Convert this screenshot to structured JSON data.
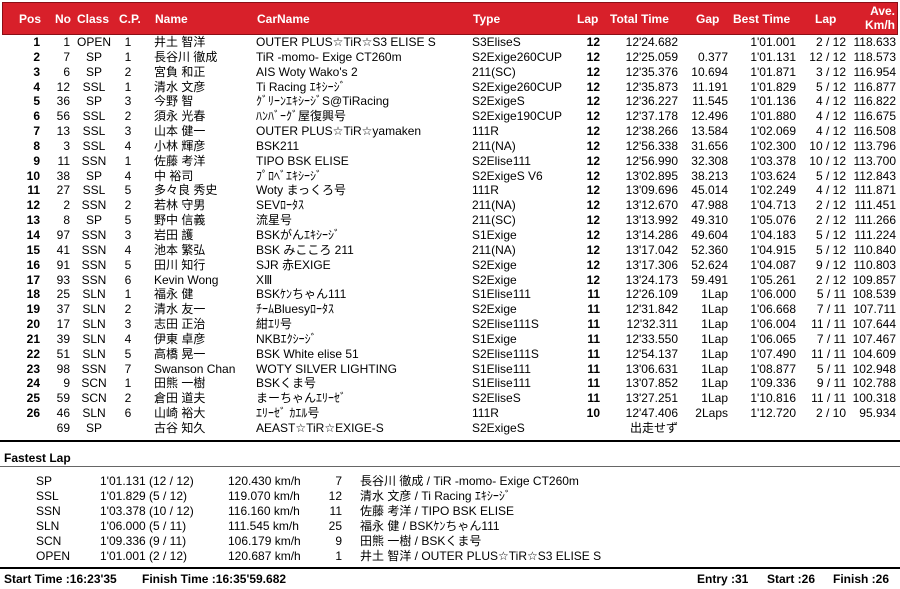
{
  "headers": {
    "pos": "Pos",
    "no": "No",
    "class": "Class",
    "cp": "C.P.",
    "name": "Name",
    "carname": "CarName",
    "type": "Type",
    "lap": "Lap",
    "total_time": "Total Time",
    "gap": "Gap",
    "best_time": "Best Time",
    "best_lap": "Lap",
    "ave_line1": "Ave.",
    "ave_line2": "Km/h"
  },
  "rows": [
    {
      "pos": "1",
      "no": "1",
      "class": "OPEN",
      "cp": "1",
      "name": "井土 智洋",
      "car": "OUTER PLUS☆TiR☆S3 ELISE S",
      "type": "S3EliseS",
      "lap": "12",
      "total": "12'24.682",
      "gap": "",
      "best": "1'01.001",
      "blap": "2 / 12",
      "ave": "118.633"
    },
    {
      "pos": "2",
      "no": "7",
      "class": "SP",
      "cp": "1",
      "name": "長谷川 徹成",
      "car": "TiR -momo- Exige CT260m",
      "type": "S2Exige260CUP",
      "lap": "12",
      "total": "12'25.059",
      "gap": "0.377",
      "best": "1'01.131",
      "blap": "12 / 12",
      "ave": "118.573"
    },
    {
      "pos": "3",
      "no": "6",
      "class": "SP",
      "cp": "2",
      "name": "宮負 和正",
      "car": "AIS Woty Wako's 2",
      "type": "211(SC)",
      "lap": "12",
      "total": "12'35.376",
      "gap": "10.694",
      "best": "1'01.871",
      "blap": "3 / 12",
      "ave": "116.954"
    },
    {
      "pos": "4",
      "no": "12",
      "class": "SSL",
      "cp": "1",
      "name": "清水 文彦",
      "car": "Ti Racing ｴｷｼｰｼﾞ",
      "type": "S2Exige260CUP",
      "lap": "12",
      "total": "12'35.873",
      "gap": "11.191",
      "best": "1'01.829",
      "blap": "5 / 12",
      "ave": "116.877"
    },
    {
      "pos": "5",
      "no": "36",
      "class": "SP",
      "cp": "3",
      "name": "今野 智",
      "car": "ｸﾞﾘｰﾝｴｷｼｰｼﾞS@TiRacing",
      "type": "S2ExigeS",
      "lap": "12",
      "total": "12'36.227",
      "gap": "11.545",
      "best": "1'01.136",
      "blap": "4 / 12",
      "ave": "116.822"
    },
    {
      "pos": "6",
      "no": "56",
      "class": "SSL",
      "cp": "2",
      "name": "須永 光春",
      "car": "ﾊﾝﾊﾞｰｸﾞ屋復興号",
      "type": "S2Exige190CUP",
      "lap": "12",
      "total": "12'37.178",
      "gap": "12.496",
      "best": "1'01.880",
      "blap": "4 / 12",
      "ave": "116.675"
    },
    {
      "pos": "7",
      "no": "13",
      "class": "SSL",
      "cp": "3",
      "name": "山本 健一",
      "car": "OUTER PLUS☆TiR☆yamaken",
      "type": "111R",
      "lap": "12",
      "total": "12'38.266",
      "gap": "13.584",
      "best": "1'02.069",
      "blap": "4 / 12",
      "ave": "116.508"
    },
    {
      "pos": "8",
      "no": "3",
      "class": "SSL",
      "cp": "4",
      "name": "小林 輝彦",
      "car": "BSK211",
      "type": "211(NA)",
      "lap": "12",
      "total": "12'56.338",
      "gap": "31.656",
      "best": "1'02.300",
      "blap": "10 / 12",
      "ave": "113.796"
    },
    {
      "pos": "9",
      "no": "11",
      "class": "SSN",
      "cp": "1",
      "name": "佐藤 考洋",
      "car": "TIPO BSK ELISE",
      "type": "S2Elise111",
      "lap": "12",
      "total": "12'56.990",
      "gap": "32.308",
      "best": "1'03.378",
      "blap": "10 / 12",
      "ave": "113.700"
    },
    {
      "pos": "10",
      "no": "38",
      "class": "SP",
      "cp": "4",
      "name": "中 裕司",
      "car": "ﾌﾟﾛﾍﾞｴｷｼｰｼﾞ",
      "type": "S2ExigeS V6",
      "lap": "12",
      "total": "13'02.895",
      "gap": "38.213",
      "best": "1'03.624",
      "blap": "5 / 12",
      "ave": "112.843"
    },
    {
      "pos": "11",
      "no": "27",
      "class": "SSL",
      "cp": "5",
      "name": "多々良 秀史",
      "car": "Woty まっくろ号",
      "type": "111R",
      "lap": "12",
      "total": "13'09.696",
      "gap": "45.014",
      "best": "1'02.249",
      "blap": "4 / 12",
      "ave": "111.871"
    },
    {
      "pos": "12",
      "no": "2",
      "class": "SSN",
      "cp": "2",
      "name": "若林 守男",
      "car": "SEVﾛｰﾀｽ",
      "type": "211(NA)",
      "lap": "12",
      "total": "13'12.670",
      "gap": "47.988",
      "best": "1'04.713",
      "blap": "2 / 12",
      "ave": "111.451"
    },
    {
      "pos": "13",
      "no": "8",
      "class": "SP",
      "cp": "5",
      "name": "野中 信義",
      "car": "流星号",
      "type": "211(SC)",
      "lap": "12",
      "total": "13'13.992",
      "gap": "49.310",
      "best": "1'05.076",
      "blap": "2 / 12",
      "ave": "111.266"
    },
    {
      "pos": "14",
      "no": "97",
      "class": "SSN",
      "cp": "3",
      "name": "岩田 護",
      "car": "BSKがんｴｷｼｰｼﾞ",
      "type": "S1Exige",
      "lap": "12",
      "total": "13'14.286",
      "gap": "49.604",
      "best": "1'04.183",
      "blap": "5 / 12",
      "ave": "111.224"
    },
    {
      "pos": "15",
      "no": "41",
      "class": "SSN",
      "cp": "4",
      "name": "池本 繁弘",
      "car": "BSK みこころ 211",
      "type": "211(NA)",
      "lap": "12",
      "total": "13'17.042",
      "gap": "52.360",
      "best": "1'04.915",
      "blap": "5 / 12",
      "ave": "110.840"
    },
    {
      "pos": "16",
      "no": "91",
      "class": "SSN",
      "cp": "5",
      "name": "田川 知行",
      "car": "SJR 赤EXIGE",
      "type": "S2Exige",
      "lap": "12",
      "total": "13'17.306",
      "gap": "52.624",
      "best": "1'04.087",
      "blap": "9 / 12",
      "ave": "110.803"
    },
    {
      "pos": "17",
      "no": "93",
      "class": "SSN",
      "cp": "6",
      "name": "Kevin Wong",
      "car": "XⅢ",
      "type": "S2Exige",
      "lap": "12",
      "total": "13'24.173",
      "gap": "59.491",
      "best": "1'05.261",
      "blap": "2 / 12",
      "ave": "109.857"
    },
    {
      "pos": "18",
      "no": "25",
      "class": "SLN",
      "cp": "1",
      "name": "福永 健",
      "car": "BSKｹﾝちゃん111",
      "type": "S1Elise111",
      "lap": "11",
      "total": "12'26.109",
      "gap": "1Lap",
      "best": "1'06.000",
      "blap": "5 / 11",
      "ave": "108.539"
    },
    {
      "pos": "19",
      "no": "37",
      "class": "SLN",
      "cp": "2",
      "name": "清水 友一",
      "car": "ﾁｰﾑBluesyﾛｰﾀｽ",
      "type": "S2Exige",
      "lap": "11",
      "total": "12'31.842",
      "gap": "1Lap",
      "best": "1'06.668",
      "blap": "7 / 11",
      "ave": "107.711"
    },
    {
      "pos": "20",
      "no": "17",
      "class": "SLN",
      "cp": "3",
      "name": "志田 正治",
      "car": "紺ｴﾘ号",
      "type": "S2Elise111S",
      "lap": "11",
      "total": "12'32.311",
      "gap": "1Lap",
      "best": "1'06.004",
      "blap": "11 / 11",
      "ave": "107.644"
    },
    {
      "pos": "21",
      "no": "39",
      "class": "SLN",
      "cp": "4",
      "name": "伊東 卓彦",
      "car": "NKBｴｸｼｰｼﾞ",
      "type": "S1Exige",
      "lap": "11",
      "total": "12'33.550",
      "gap": "1Lap",
      "best": "1'06.065",
      "blap": "7 / 11",
      "ave": "107.467"
    },
    {
      "pos": "22",
      "no": "51",
      "class": "SLN",
      "cp": "5",
      "name": "高橋 晃一",
      "car": "BSK White elise 51",
      "type": "S2Elise111S",
      "lap": "11",
      "total": "12'54.137",
      "gap": "1Lap",
      "best": "1'07.490",
      "blap": "11 / 11",
      "ave": "104.609"
    },
    {
      "pos": "23",
      "no": "98",
      "class": "SSN",
      "cp": "7",
      "name": "Swanson Chan",
      "car": "WOTY SILVER LIGHTING",
      "type": "S1Elise111",
      "lap": "11",
      "total": "13'06.631",
      "gap": "1Lap",
      "best": "1'08.877",
      "blap": "5 / 11",
      "ave": "102.948"
    },
    {
      "pos": "24",
      "no": "9",
      "class": "SCN",
      "cp": "1",
      "name": "田熊 一樹",
      "car": "BSKくま号",
      "type": "S1Elise111",
      "lap": "11",
      "total": "13'07.852",
      "gap": "1Lap",
      "best": "1'09.336",
      "blap": "9 / 11",
      "ave": "102.788"
    },
    {
      "pos": "25",
      "no": "59",
      "class": "SCN",
      "cp": "2",
      "name": "倉田 道夫",
      "car": "まーちゃんｴﾘｰｾﾞ",
      "type": "S2EliseS",
      "lap": "11",
      "total": "13'27.251",
      "gap": "1Lap",
      "best": "1'10.816",
      "blap": "11 / 11",
      "ave": "100.318"
    },
    {
      "pos": "26",
      "no": "46",
      "class": "SLN",
      "cp": "6",
      "name": "山崎 裕大",
      "car": "ｴﾘｰｾﾞ ｶｴﾙ号",
      "type": "111R",
      "lap": "10",
      "total": "12'47.406",
      "gap": "2Laps",
      "best": "1'12.720",
      "blap": "2 / 10",
      "ave": "95.934"
    },
    {
      "pos": "",
      "no": "69",
      "class": "SP",
      "cp": "",
      "name": "古谷 知久",
      "car": "AEAST☆TiR☆EXIGE-S",
      "type": "S2ExigeS",
      "lap": "",
      "total": "出走せず",
      "gap": "",
      "best": "",
      "blap": "",
      "ave": ""
    }
  ],
  "fastest": {
    "title": "Fastest Lap",
    "rows": [
      {
        "class": "SP",
        "time": "1'01.131 (12 / 12)",
        "speed": "120.430 km/h",
        "no": "7",
        "driver": "長谷川 徹成 / TiR -momo- Exige CT260m"
      },
      {
        "class": "SSL",
        "time": "1'01.829 (5 / 12)",
        "speed": "119.070 km/h",
        "no": "12",
        "driver": "清水 文彦 / Ti Racing ｴｷｼｰｼﾞ"
      },
      {
        "class": "SSN",
        "time": "1'03.378 (10 / 12)",
        "speed": "116.160 km/h",
        "no": "11",
        "driver": "佐藤 考洋 / TIPO BSK ELISE"
      },
      {
        "class": "SLN",
        "time": "1'06.000 (5 / 11)",
        "speed": "111.545 km/h",
        "no": "25",
        "driver": "福永 健 / BSKｹﾝちゃん111"
      },
      {
        "class": "SCN",
        "time": "1'09.336 (9 / 11)",
        "speed": "106.179 km/h",
        "no": "9",
        "driver": "田熊 一樹 / BSKくま号"
      },
      {
        "class": "OPEN",
        "time": "1'01.001 (2 / 12)",
        "speed": "120.687 km/h",
        "no": "1",
        "driver": "井土 智洋 / OUTER PLUS☆TiR☆S3 ELISE S"
      }
    ]
  },
  "footer": {
    "start_time": "Start Time :16:23'35",
    "finish_time": "Finish Time :16:35'59.682",
    "entry": "Entry :31",
    "start": "Start :26",
    "finish": "Finish :26"
  },
  "colors": {
    "header_bg": "#d8202a",
    "header_text": "#ffffff"
  }
}
